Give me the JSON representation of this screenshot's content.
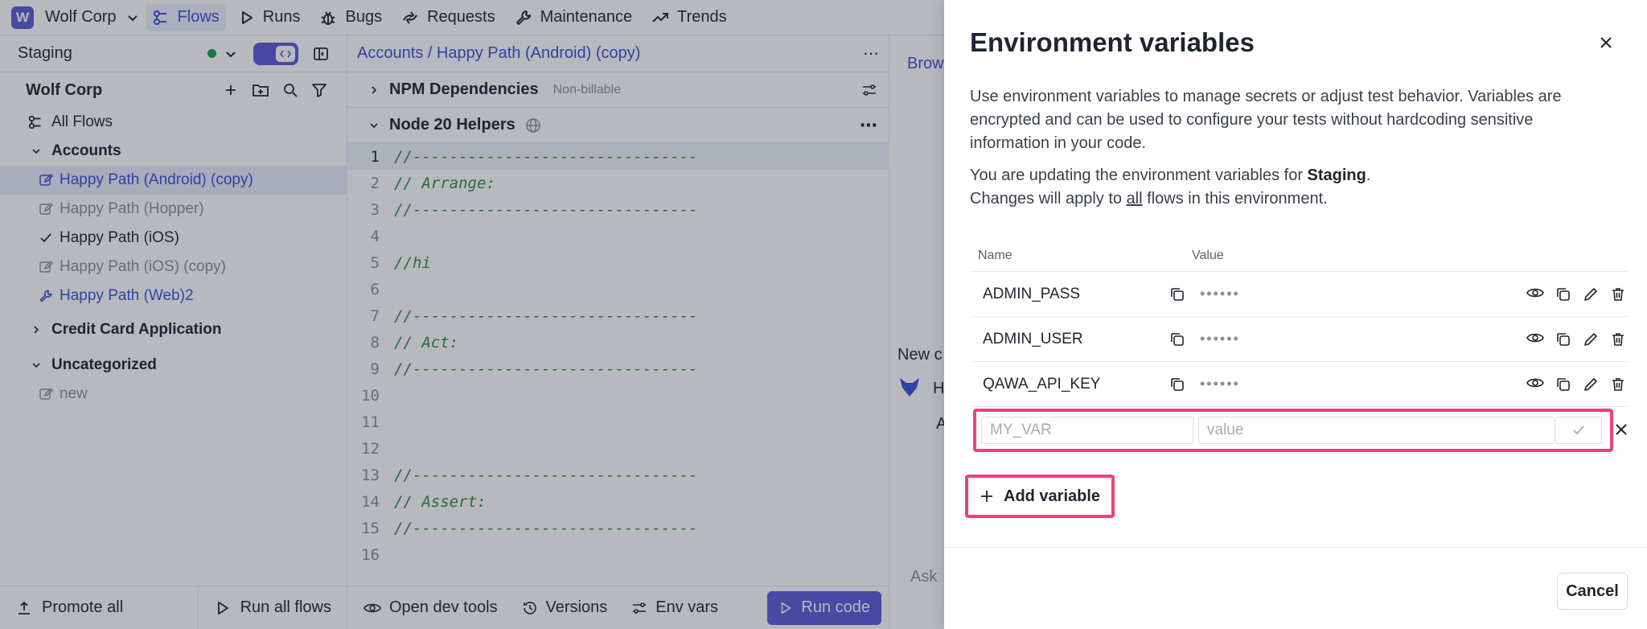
{
  "topnav": {
    "logo_letter": "W",
    "org_name": "Wolf Corp",
    "items": [
      {
        "label": "Flows",
        "icon": "flows-icon",
        "active": true
      },
      {
        "label": "Runs",
        "icon": "play-icon"
      },
      {
        "label": "Bugs",
        "icon": "bug-icon"
      },
      {
        "label": "Requests",
        "icon": "requests-icon"
      },
      {
        "label": "Maintenance",
        "icon": "wrench-icon"
      },
      {
        "label": "Trends",
        "icon": "trend-icon"
      }
    ]
  },
  "sidebar": {
    "environment": "Staging",
    "org_label": "Wolf Corp",
    "all_flows": "All Flows",
    "folders": [
      {
        "label": "Accounts"
      },
      {
        "label": "Credit Card Application"
      },
      {
        "label": "Uncategorized"
      }
    ],
    "flows": [
      {
        "label": "Happy Path (Android) (copy)"
      },
      {
        "label": "Happy Path (Hopper)"
      },
      {
        "label": "Happy Path (iOS)"
      },
      {
        "label": "Happy Path (iOS) (copy)"
      },
      {
        "label": "Happy Path (Web)2"
      },
      {
        "label": "new"
      }
    ],
    "footer": {
      "promote": "Promote all",
      "run_all": "Run all flows"
    }
  },
  "editor": {
    "breadcrumb": "Accounts / Happy Path (Android) (copy)",
    "npm_label": "NPM Dependencies",
    "npm_tag": "Non-billable",
    "helpers_label": "Node 20 Helpers",
    "lines": [
      {
        "n": "1",
        "text": "//-------------------------------"
      },
      {
        "n": "2",
        "text": "// Arrange:"
      },
      {
        "n": "3",
        "text": "//-------------------------------"
      },
      {
        "n": "4",
        "text": ""
      },
      {
        "n": "5",
        "text": "//hi"
      },
      {
        "n": "6",
        "text": ""
      },
      {
        "n": "7",
        "text": "//-------------------------------"
      },
      {
        "n": "8",
        "text": "// Act:"
      },
      {
        "n": "9",
        "text": "//-------------------------------"
      },
      {
        "n": "10",
        "text": ""
      },
      {
        "n": "11",
        "text": ""
      },
      {
        "n": "12",
        "text": ""
      },
      {
        "n": "13",
        "text": "//-------------------------------"
      },
      {
        "n": "14",
        "text": "// Assert:"
      },
      {
        "n": "15",
        "text": "//-------------------------------"
      },
      {
        "n": "16",
        "text": ""
      }
    ],
    "footer": {
      "dev_tools": "Open dev tools",
      "versions": "Versions",
      "env_vars": "Env vars",
      "run_code": "Run code"
    }
  },
  "right_panel": {
    "browser_tab": "Brow",
    "new_label": "New c",
    "h_label": "H",
    "a_label": "A",
    "ask_label": "Ask"
  },
  "modal": {
    "title": "Environment variables",
    "description": "Use environment variables to manage secrets or adjust test behavior. Variables are encrypted and can be used to configure your tests without hardcoding sensitive information in your code.",
    "env_prefix": "You are updating the environment variables for ",
    "env_name": "Staging",
    "env_suffix": ".",
    "apply_prefix": "Changes will apply to ",
    "apply_emph": "all",
    "apply_suffix": " flows in this environment.",
    "col_name": "Name",
    "col_value": "Value",
    "variables": [
      {
        "name": "ADMIN_PASS",
        "masked": "••••••"
      },
      {
        "name": "ADMIN_USER",
        "masked": "••••••"
      },
      {
        "name": "QAWA_API_KEY",
        "masked": "••••••"
      }
    ],
    "new_name_placeholder": "MY_VAR",
    "new_value_placeholder": "value",
    "add_label": "Add variable",
    "cancel_label": "Cancel"
  }
}
